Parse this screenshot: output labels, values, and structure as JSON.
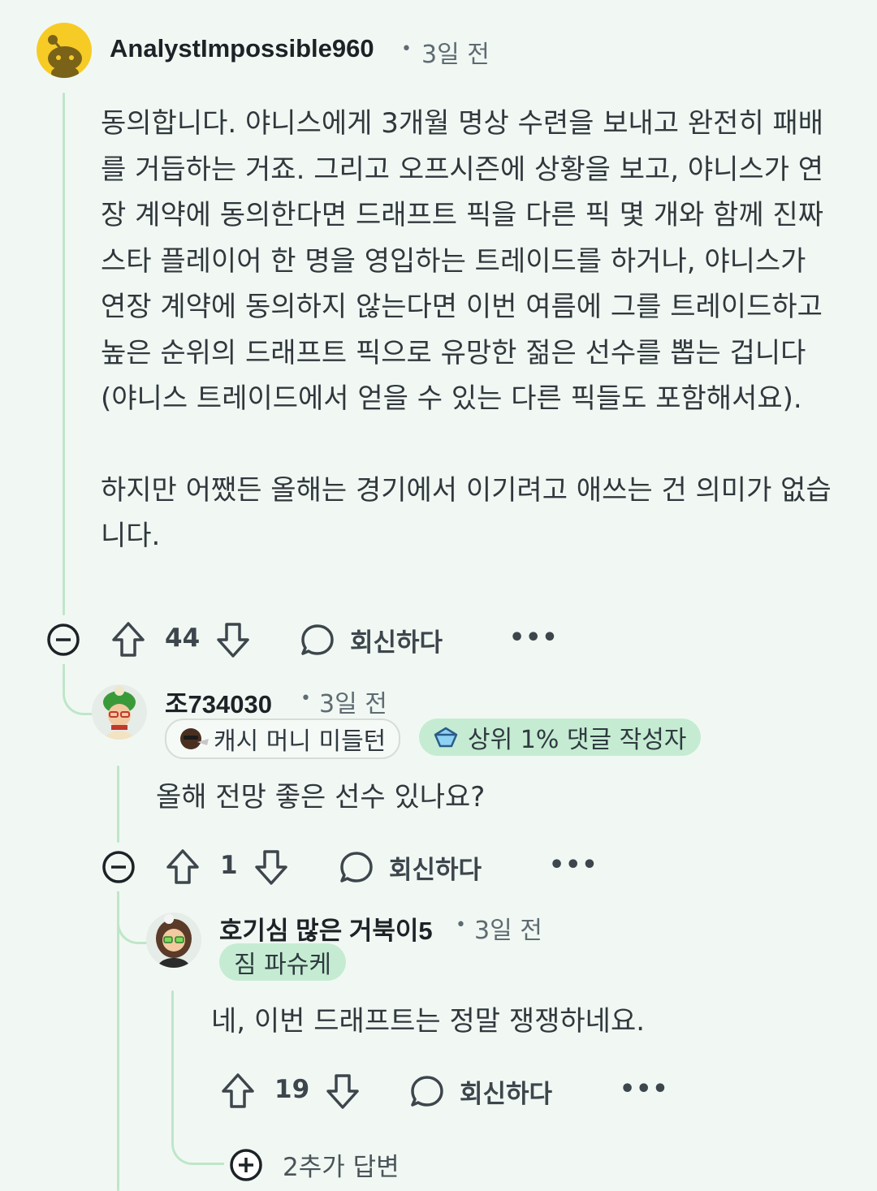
{
  "comments": [
    {
      "username": "AnalystImpossible960",
      "time": "3일 전",
      "body": [
        "동의합니다. 야니스에게 3개월 명상 수련을 보내고 완전히 패배를 거듭하는 거죠. 그리고 오프시즌에 상황을 보고, 야니스가 연장 계약에 동의한다면 드래프트 픽을 다른 픽 몇 개와 함께 진짜 스타 플레이어 한 명을 영입하는 트레이드를 하거나, 야니스가 연장 계약에 동의하지 않는다면 이번 여름에 그를 트레이드하고 높은 순위의 드래프트 픽으로 유망한 젊은 선수를 뽑는 겁니다 (야니스 트레이드에서 얻을 수 있는 다른 픽들도 포함해서요).",
        "하지만 어쨌든 올해는 경기에서 이기려고 애쓰는 건 의미가 없습니다."
      ],
      "votes": "44",
      "reply_label": "회신하다"
    },
    {
      "username": "조734030",
      "time": "3일 전",
      "flairs": [
        {
          "text": "캐시 머니 미들턴",
          "icon": "middleton-face-icon"
        },
        {
          "text": "상위 1% 댓글 작성자",
          "icon": "top-commenter-icon"
        }
      ],
      "body": [
        "올해 전망 좋은 선수 있나요?"
      ],
      "votes": "1",
      "reply_label": "회신하다"
    },
    {
      "username": "호기심 많은 거북이5",
      "time": "3일 전",
      "flairs": [
        {
          "text": "짐 파슈케"
        }
      ],
      "body": [
        "네, 이번 드래프트는 정말 쟁쟁하네요."
      ],
      "votes": "19",
      "reply_label": "회신하다"
    }
  ],
  "more_replies": "2추가 답변",
  "colors": {
    "background": "#f1f8f3",
    "thread_line": "#bfe6c9",
    "flair_green": "#c5ecd2",
    "avatar_yellow": "#f7cb25"
  }
}
